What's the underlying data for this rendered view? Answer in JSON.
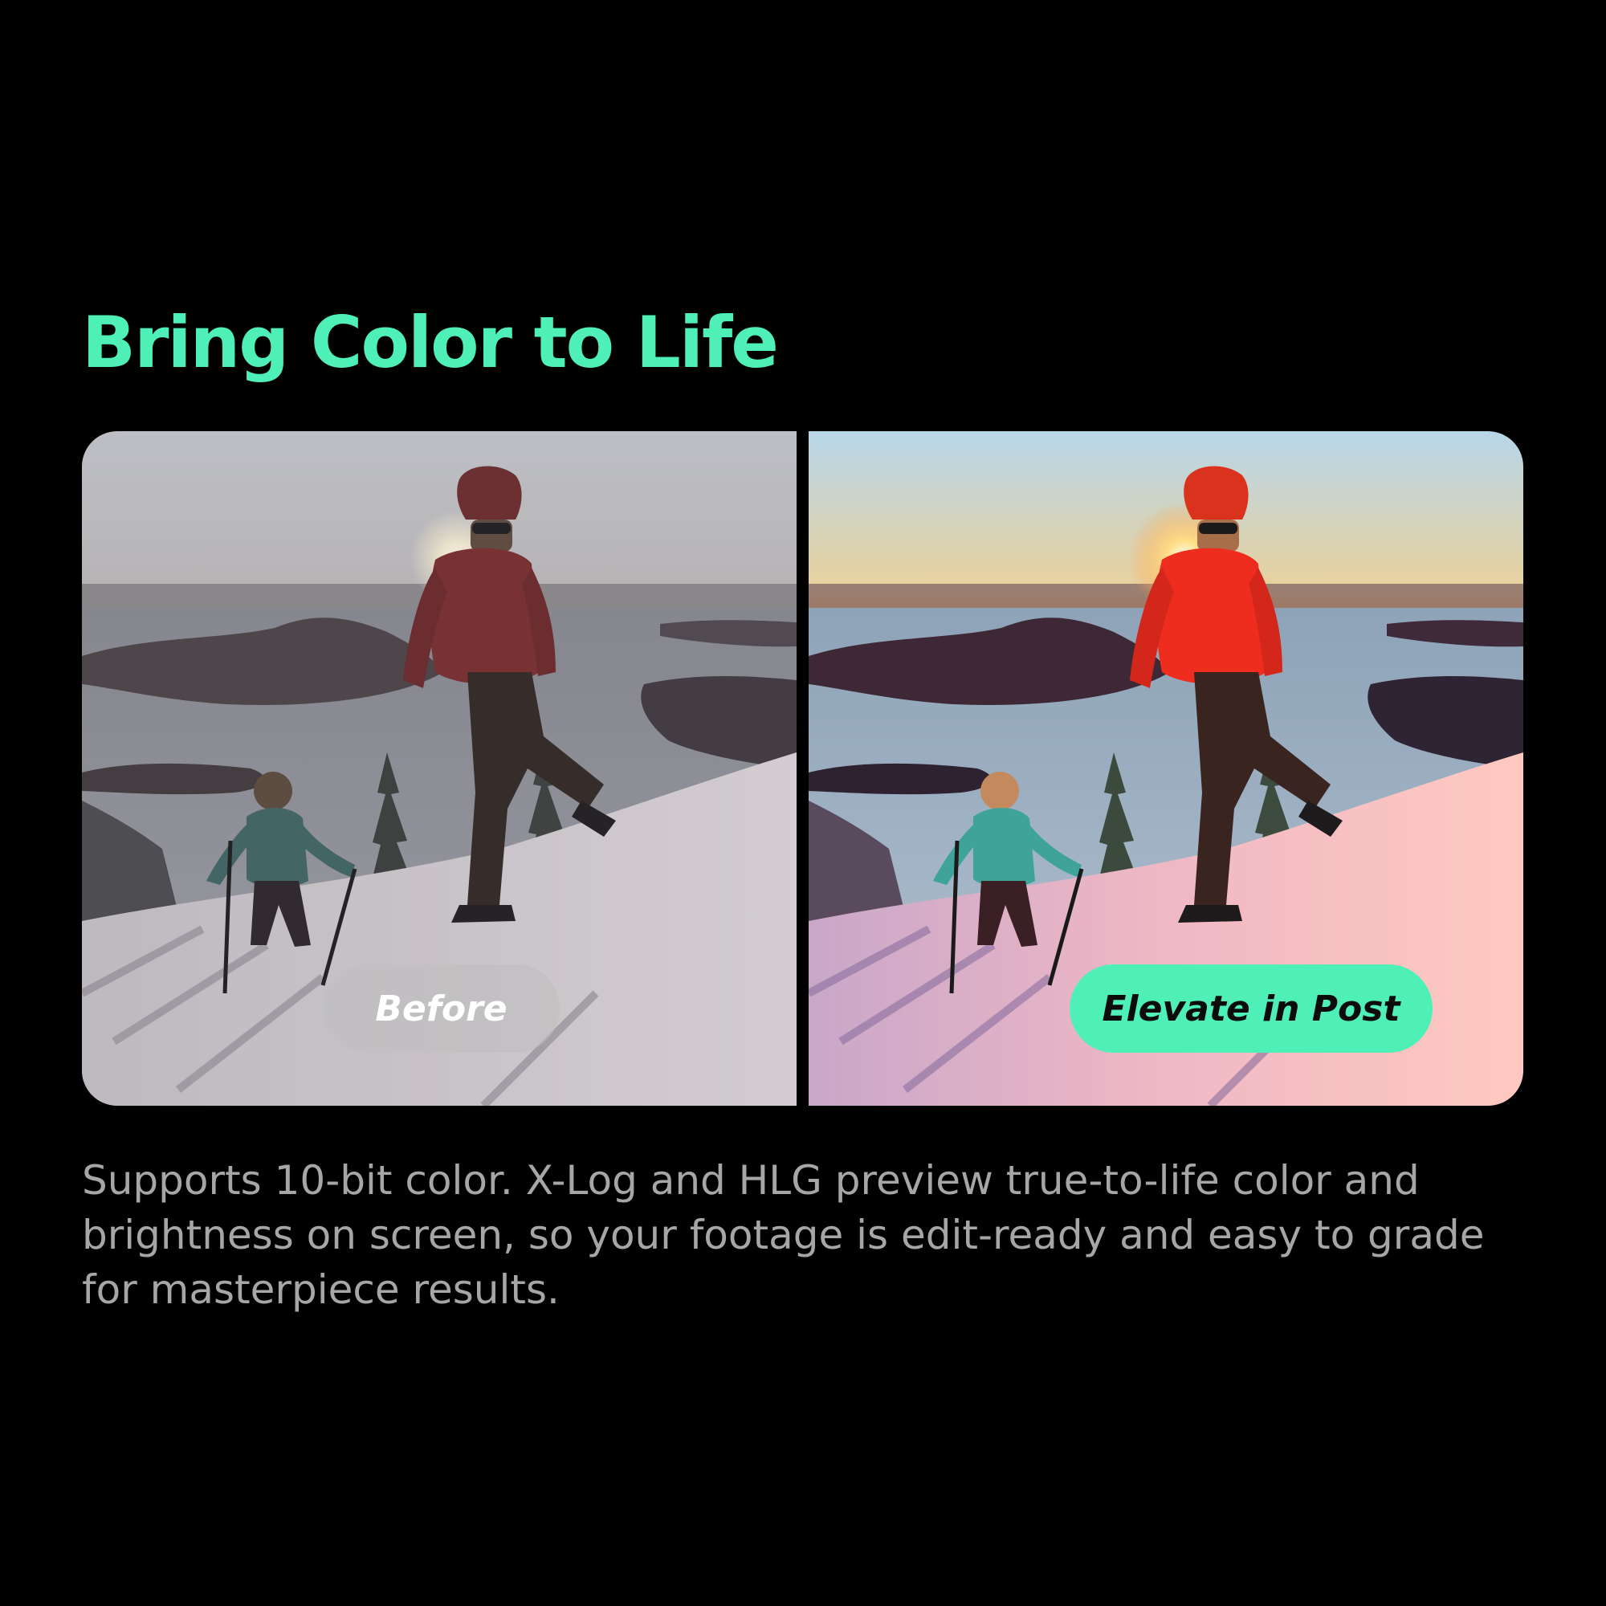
{
  "headline": "Bring Color to Life",
  "comparison": {
    "before_label": "Before",
    "after_label": "Elevate in Post"
  },
  "description": "Supports 10-bit color. X-Log and HLG preview true-to-life color and brightness on screen, so your footage is edit-ready and easy to grade for masterpiece results.",
  "colors": {
    "background": "#000000",
    "accent": "#4ff0b8",
    "body_text": "#a6a6a6",
    "before_pill": "rgba(190,190,190,0.55)",
    "after_pill": "#4ff0b8"
  }
}
